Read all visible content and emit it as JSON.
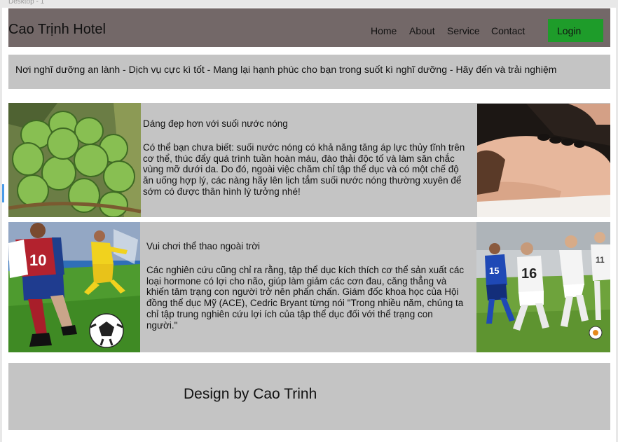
{
  "canvas": {
    "label": "Desktop - 1"
  },
  "header": {
    "title": "Cao Trịnh Hotel",
    "nav": [
      "Home",
      "About",
      "Service",
      "Contact"
    ],
    "login_label": "Login"
  },
  "tagline": "Nơi nghĩ dưỡng an lành - Dịch vụ cực kì tốt - Mang lại hạnh phúc cho bạn trong suốt kì nghĩ dưỡng - Hãy đến và trải nghiệm",
  "rows": [
    {
      "heading": "Dáng đẹp hơn với suối nước nóng",
      "body": "Có thể bạn chưa biết: suối nước nóng có khả năng tăng áp lực thủy tĩnh trên cơ thể, thúc đẩy quá trình tuần hoàn máu, đào thải độc tố và làm săn chắc vùng mỡ dưới da. Do đó, ngoài việc chăm chỉ tập thể dục và có một chế độ ăn uống hợp lý, các nàng hãy lên lịch tắm suối nước nóng thường xuyên để sớm có được thân hình lý tưởng nhé!"
    },
    {
      "heading": "Vui chơi thể thao ngoài trời",
      "body": "Các nghiên cứu cũng chỉ ra rằng, tập thể dục kích thích cơ thể sản xuất các loại hormone có lợi cho não, giúp làm giảm các cơn đau, căng thẳng và khiến tâm trạng con người trở nên phấn chấn. Giám đốc khoa học của Hội đồng thể dục Mỹ (ACE), Cedric Bryant từng nói \"Trong nhiều năm, chúng ta chỉ tập trung nghiên cứu lợi ích của tập thể dục đối với thể trạng con người.\""
    }
  ],
  "photos": {
    "row1_left": {
      "icon": "coconuts-photo",
      "shirt_number": ""
    },
    "row1_right": {
      "icon": "massage-photo"
    },
    "row2_left": {
      "icon": "football-player-photo",
      "shirt_number": "10"
    },
    "row2_right": {
      "icon": "womens-football-photo",
      "shirt_numbers": [
        "15",
        "16",
        "11"
      ]
    }
  },
  "footer": {
    "text": "Design by Cao Trinh"
  },
  "colors": {
    "header_bg": "#736868",
    "login_bg": "#1e9c2a",
    "panel_bg": "#c4c4c4",
    "selection": "#2f8be6"
  }
}
